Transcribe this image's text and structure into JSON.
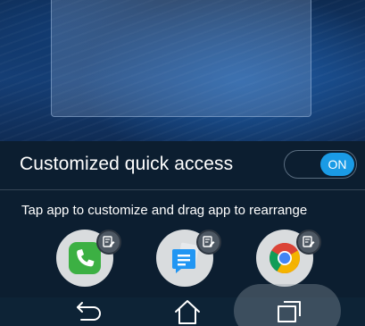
{
  "quick_access": {
    "title": "Customized quick access",
    "toggle_state": "ON",
    "hint": "Tap app to customize and drag app to rearrange"
  },
  "apps": [
    {
      "name": "phone-app-icon",
      "color": "#3cb043"
    },
    {
      "name": "messages-app-icon",
      "color": "#2196f3"
    },
    {
      "name": "chrome-app-icon",
      "color": "#db4437"
    }
  ],
  "colors": {
    "accent": "#1a9be6",
    "panel": "#0c1e30"
  },
  "navigation": [
    "back-icon",
    "home-icon",
    "recent-apps-icon"
  ]
}
